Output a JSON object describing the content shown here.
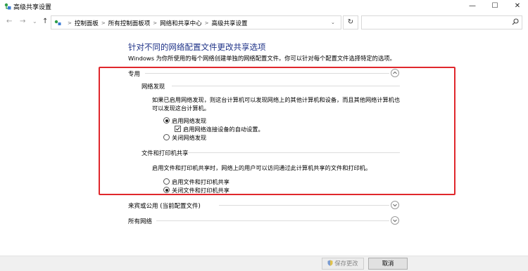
{
  "window": {
    "title": "高级共享设置",
    "controls": {
      "minimize": "—",
      "maximize": "☐",
      "close": "✕"
    }
  },
  "nav": {
    "back": "←",
    "forward": "→",
    "history": "⌄",
    "up": "↑",
    "breadcrumbs": [
      "控制面板",
      "所有控制面板项",
      "网络和共享中心",
      "高级共享设置"
    ],
    "breadcrumb_separator": ">",
    "dropdown": "⌄",
    "refresh": "↻",
    "search_placeholder": ""
  },
  "main": {
    "heading": "针对不同的网络配置文件更改共享选项",
    "description": "Windows 为你所使用的每个网络创建单独的网络配置文件。你可以针对每个配置文件选择特定的选项。",
    "profiles": [
      {
        "label": "专用",
        "expanded": true,
        "sections": [
          {
            "title": "网络发现",
            "text_line1": "如果已启用网络发现，则这台计算机可以发现网络上的其他计算机和设备，而且其他网络计算机也",
            "text_line2": "可以发现这台计算机。",
            "options": [
              {
                "label": "启用网络发现",
                "selected": true
              },
              {
                "label": "启用网络连接设备的自动设置。",
                "checked": true,
                "type": "checkbox"
              },
              {
                "label": "关闭网络发现",
                "selected": false
              }
            ]
          },
          {
            "title": "文件和打印机共享",
            "text_line1": "启用文件和打印机共享时，网络上的用户可以访问通过此计算机共享的文件和打印机。",
            "options": [
              {
                "label": "启用文件和打印机共享",
                "selected": false
              },
              {
                "label": "关闭文件和打印机共享",
                "selected": true
              }
            ]
          }
        ]
      },
      {
        "label": "来宾或公用 (当前配置文件)",
        "expanded": false
      },
      {
        "label": "所有网络",
        "expanded": false
      }
    ]
  },
  "footer": {
    "save_label": "保存更改",
    "cancel_label": "取消"
  },
  "colors": {
    "heading": "#1e3287",
    "highlight_border": "#e0272c",
    "icon_green": "#2e9e4a"
  },
  "icons": {
    "title": "network-sharing-icon",
    "address": "network-sharing-icon",
    "search": "search-icon",
    "chevron_up": "chevron-up-icon",
    "chevron_down": "chevron-down-icon",
    "shield": "uac-shield-icon"
  }
}
